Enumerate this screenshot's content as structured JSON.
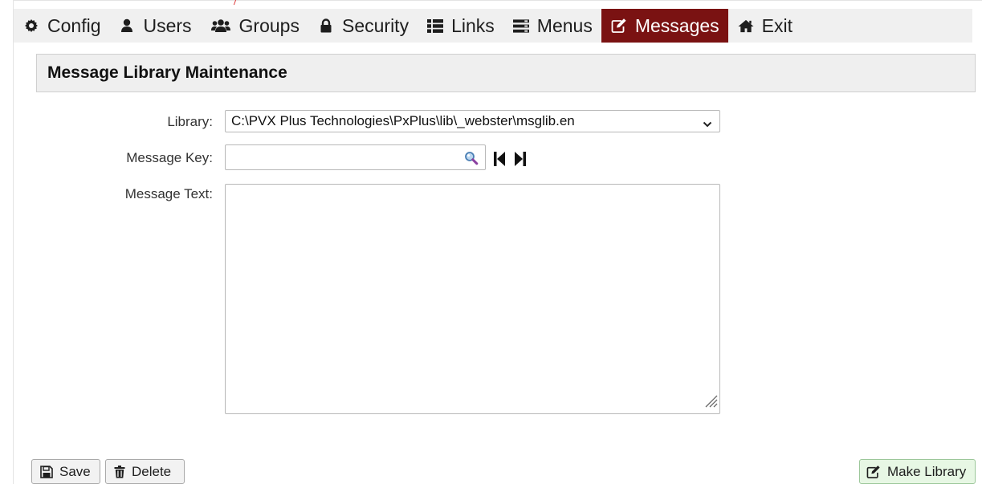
{
  "nav": {
    "items": [
      {
        "label": "Config",
        "icon": "gear-icon"
      },
      {
        "label": "Users",
        "icon": "user-icon"
      },
      {
        "label": "Groups",
        "icon": "users-icon"
      },
      {
        "label": "Security",
        "icon": "lock-icon"
      },
      {
        "label": "Links",
        "icon": "list-icon"
      },
      {
        "label": "Menus",
        "icon": "menu-icon"
      },
      {
        "label": "Messages",
        "icon": "edit-icon",
        "active": true
      },
      {
        "label": "Exit",
        "icon": "home-icon"
      }
    ],
    "active_color": "#7a1212"
  },
  "panel": {
    "title": "Message Library Maintenance"
  },
  "form": {
    "library_label": "Library:",
    "library_value": "C:\\PVX Plus Technologies\\PxPlus\\lib\\_webster\\msglib.en",
    "key_label": "Message Key:",
    "key_value": "",
    "text_label": "Message Text:",
    "text_value": ""
  },
  "buttons": {
    "save": "Save",
    "delete": "Delete",
    "make_library": "Make Library"
  }
}
